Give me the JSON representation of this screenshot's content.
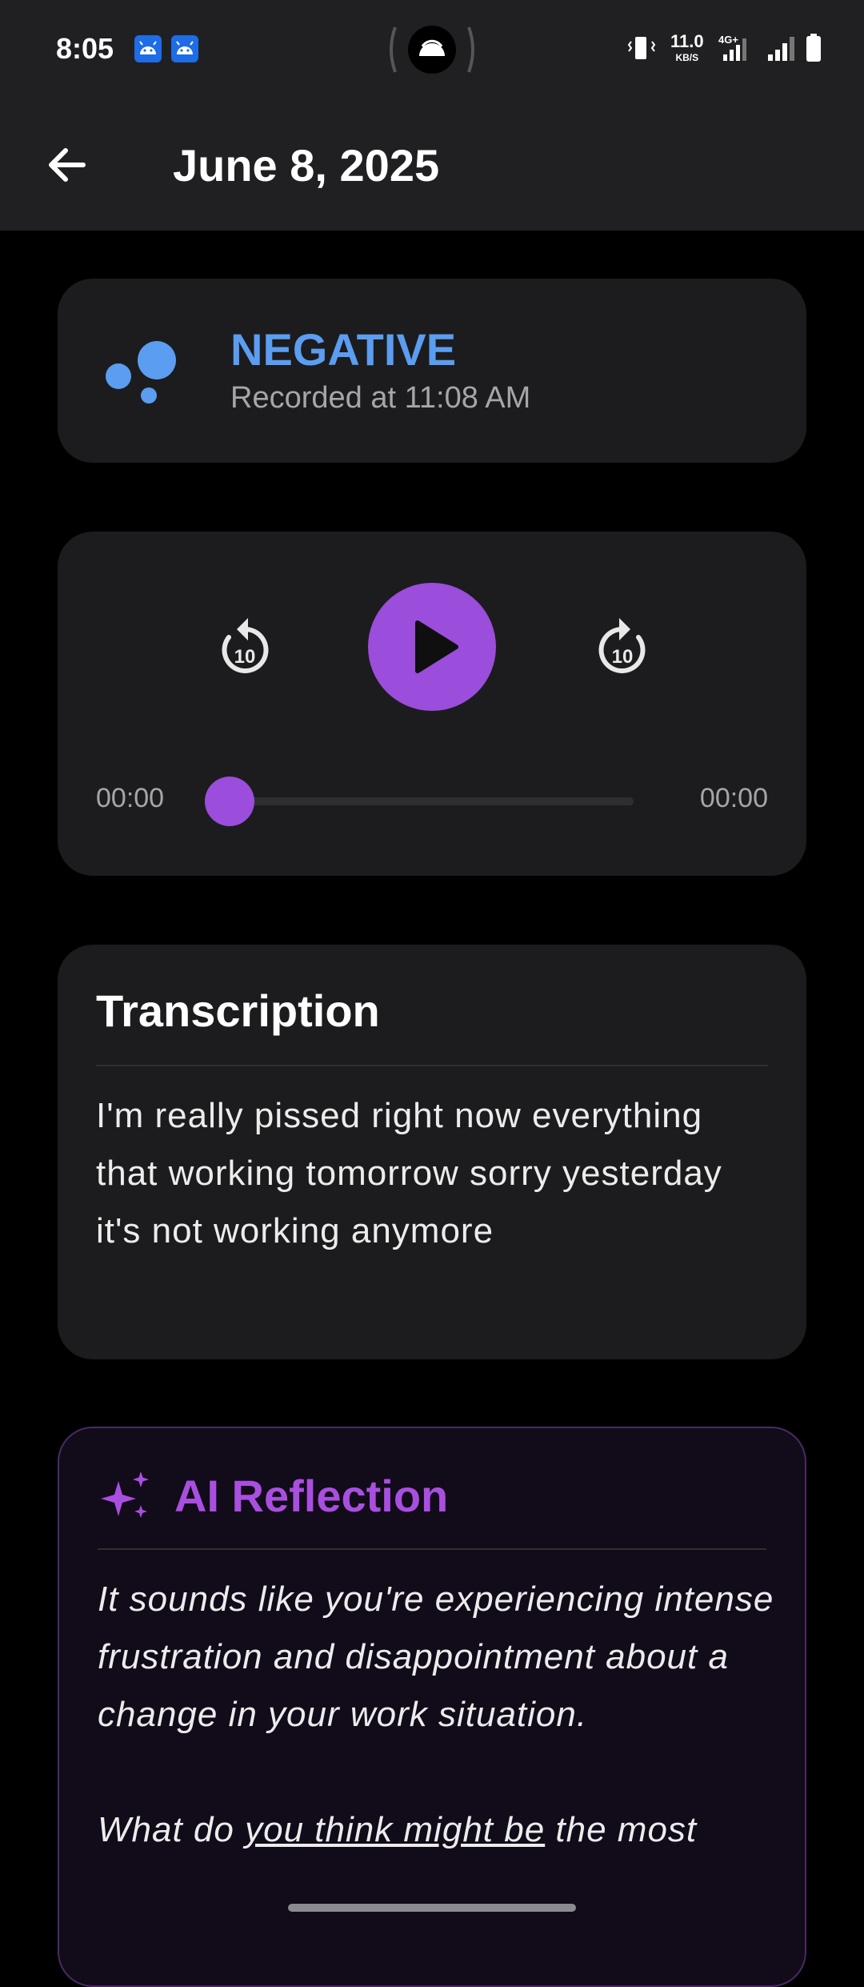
{
  "status_bar": {
    "time": "8:05",
    "speed_value": "11.0",
    "speed_unit": "KB/S",
    "network": "4G+",
    "icons": [
      "android-notification-icon",
      "android-notification-icon",
      "hotspot-icon",
      "vibrate-icon",
      "signal-icon",
      "signal-icon",
      "battery-icon"
    ]
  },
  "app_bar": {
    "title": "June 8, 2025",
    "back_icon": "arrow-left-icon"
  },
  "mood": {
    "label": "NEGATIVE",
    "recorded": "Recorded at 11:08 AM",
    "color": "#5b9df0",
    "icon": "bubbles-icon"
  },
  "player": {
    "rewind_label": "10",
    "forward_label": "10",
    "current_time": "00:00",
    "total_time": "00:00",
    "progress": 0,
    "accent": "#9b4ddb"
  },
  "transcription": {
    "title": "Transcription",
    "text": "I'm really pissed right now everything that working tomorrow sorry yesterday it's not working anymore"
  },
  "ai_reflection": {
    "title": "AI Reflection",
    "icon": "sparkles-icon",
    "paragraph_1": "It sounds like you're experiencing intense frustration and disappointment about a change in your work situation.",
    "paragraph_2_start": "What do ",
    "paragraph_2_underlined": "you think might be",
    "paragraph_2_end": " the most",
    "color": "#a94fe0"
  }
}
